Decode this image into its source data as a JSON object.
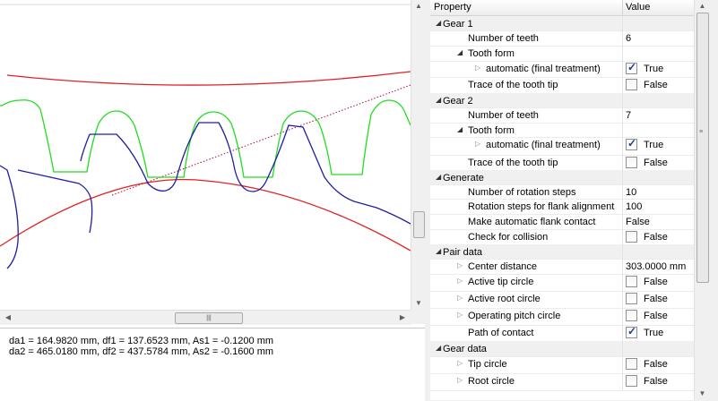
{
  "output": {
    "line1": "da1 = 164.9820 mm, df1 = 137.6523 mm, As1 = -0.1200 mm",
    "line2": "da2 = 465.0180 mm, df2 = 437.5784 mm, As2 = -0.1600 mm"
  },
  "grid": {
    "header": {
      "property": "Property",
      "value": "Value"
    },
    "rows": [
      {
        "label": "Gear 1",
        "type": "group",
        "value": ""
      },
      {
        "label": "Number of teeth",
        "type": "text",
        "value": "6"
      },
      {
        "label": "Tooth form",
        "type": "group",
        "value": ""
      },
      {
        "label": "automatic (final treatment)",
        "type": "check",
        "value": "True",
        "checked": true
      },
      {
        "label": "Trace of the tooth tip",
        "type": "check",
        "value": "False",
        "checked": false
      },
      {
        "label": "Gear 2",
        "type": "group",
        "value": ""
      },
      {
        "label": "Number of teeth",
        "type": "text",
        "value": "7"
      },
      {
        "label": "Tooth form",
        "type": "group",
        "value": ""
      },
      {
        "label": "automatic (final treatment)",
        "type": "check",
        "value": "True",
        "checked": true
      },
      {
        "label": "Trace of the tooth tip",
        "type": "check",
        "value": "False",
        "checked": false
      },
      {
        "label": "Generate",
        "type": "group",
        "value": ""
      },
      {
        "label": "Number of rotation steps",
        "type": "text",
        "value": "10"
      },
      {
        "label": "Rotation steps for flank alignment",
        "type": "text",
        "value": "100"
      },
      {
        "label": "Make automatic flank contact",
        "type": "text",
        "value": "False"
      },
      {
        "label": "Check for collision",
        "type": "check",
        "value": "False",
        "checked": false
      },
      {
        "label": "Pair data",
        "type": "group",
        "value": ""
      },
      {
        "label": "Center distance",
        "type": "text",
        "value": "303.0000 mm"
      },
      {
        "label": "Active tip circle",
        "type": "check",
        "value": "False",
        "checked": false
      },
      {
        "label": "Active root circle",
        "type": "check",
        "value": "False",
        "checked": false
      },
      {
        "label": "Operating pitch circle",
        "type": "check",
        "value": "False",
        "checked": false
      },
      {
        "label": "Path of contact",
        "type": "check",
        "value": "True",
        "checked": true
      },
      {
        "label": "Gear data",
        "type": "group",
        "value": ""
      },
      {
        "label": "Tip circle",
        "type": "check",
        "value": "False",
        "checked": false
      },
      {
        "label": "Root circle",
        "type": "check",
        "value": "False",
        "checked": false
      }
    ]
  },
  "colors": {
    "gear1": "#2020a0",
    "gear2": "#22dd22",
    "circles": "#e02020",
    "path_of_contact": "#a01040"
  }
}
